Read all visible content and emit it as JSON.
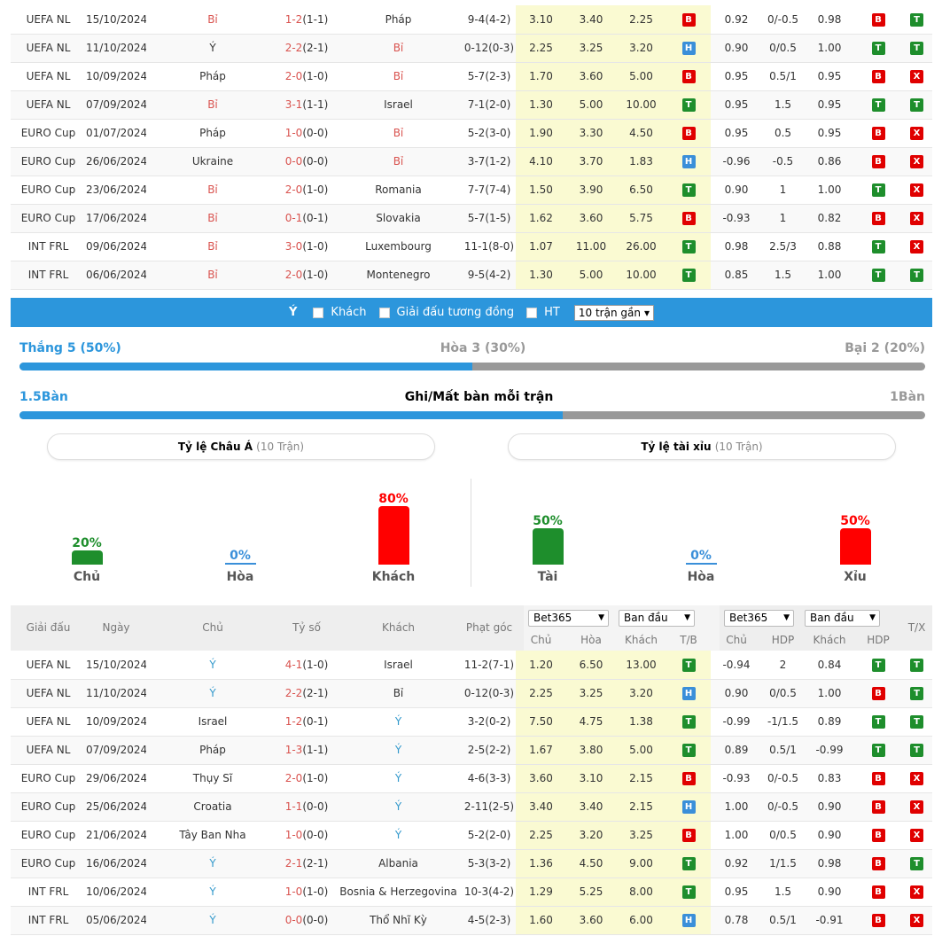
{
  "top_matches": [
    {
      "league": "UEFA NL",
      "date": "15/10/2024",
      "home": "Bỉ",
      "home_red": true,
      "score": "1-2",
      "ht": "(1-1)",
      "away": "Pháp",
      "away_red": false,
      "corners": "9-4(4-2)",
      "o1": "3.10",
      "o2": "3.40",
      "o3": "2.25",
      "res": "B",
      "h1": "0.92",
      "h2": "0/-0.5",
      "h3": "0.98",
      "r1": "B",
      "r2": "T"
    },
    {
      "league": "UEFA NL",
      "date": "11/10/2024",
      "home": "Ý",
      "home_red": false,
      "score": "2-2",
      "ht": "(2-1)",
      "away": "Bỉ",
      "away_red": true,
      "corners": "0-12(0-3)",
      "o1": "2.25",
      "o2": "3.25",
      "o3": "3.20",
      "res": "H",
      "h1": "0.90",
      "h2": "0/0.5",
      "h3": "1.00",
      "r1": "T",
      "r2": "T"
    },
    {
      "league": "UEFA NL",
      "date": "10/09/2024",
      "home": "Pháp",
      "home_red": false,
      "score": "2-0",
      "ht": "(1-0)",
      "away": "Bỉ",
      "away_red": true,
      "corners": "5-7(2-3)",
      "o1": "1.70",
      "o2": "3.60",
      "o3": "5.00",
      "res": "B",
      "h1": "0.95",
      "h2": "0.5/1",
      "h3": "0.95",
      "r1": "B",
      "r2": "X"
    },
    {
      "league": "UEFA NL",
      "date": "07/09/2024",
      "home": "Bỉ",
      "home_red": true,
      "score": "3-1",
      "ht": "(1-1)",
      "away": "Israel",
      "away_red": false,
      "corners": "7-1(2-0)",
      "o1": "1.30",
      "o2": "5.00",
      "o3": "10.00",
      "res": "T",
      "h1": "0.95",
      "h2": "1.5",
      "h3": "0.95",
      "r1": "T",
      "r2": "T"
    },
    {
      "league": "EURO Cup",
      "date": "01/07/2024",
      "home": "Pháp",
      "home_red": false,
      "score": "1-0",
      "ht": "(0-0)",
      "away": "Bỉ",
      "away_red": true,
      "corners": "5-2(3-0)",
      "o1": "1.90",
      "o2": "3.30",
      "o3": "4.50",
      "res": "B",
      "h1": "0.95",
      "h2": "0.5",
      "h3": "0.95",
      "r1": "B",
      "r2": "X"
    },
    {
      "league": "EURO Cup",
      "date": "26/06/2024",
      "home": "Ukraine",
      "home_red": false,
      "score": "0-0",
      "ht": "(0-0)",
      "away": "Bỉ",
      "away_red": true,
      "corners": "3-7(1-2)",
      "o1": "4.10",
      "o2": "3.70",
      "o3": "1.83",
      "res": "H",
      "h1": "-0.96",
      "h2": "-0.5",
      "h3": "0.86",
      "r1": "B",
      "r2": "X"
    },
    {
      "league": "EURO Cup",
      "date": "23/06/2024",
      "home": "Bỉ",
      "home_red": true,
      "score": "2-0",
      "ht": "(1-0)",
      "away": "Romania",
      "away_red": false,
      "corners": "7-7(7-4)",
      "o1": "1.50",
      "o2": "3.90",
      "o3": "6.50",
      "res": "T",
      "h1": "0.90",
      "h2": "1",
      "h3": "1.00",
      "r1": "T",
      "r2": "X"
    },
    {
      "league": "EURO Cup",
      "date": "17/06/2024",
      "home": "Bỉ",
      "home_red": true,
      "score": "0-1",
      "ht": "(0-1)",
      "away": "Slovakia",
      "away_red": false,
      "corners": "5-7(1-5)",
      "o1": "1.62",
      "o2": "3.60",
      "o3": "5.75",
      "res": "B",
      "h1": "-0.93",
      "h2": "1",
      "h3": "0.82",
      "r1": "B",
      "r2": "X"
    },
    {
      "league": "INT FRL",
      "date": "09/06/2024",
      "home": "Bỉ",
      "home_red": true,
      "score": "3-0",
      "ht": "(1-0)",
      "away": "Luxembourg",
      "away_red": false,
      "corners": "11-1(8-0)",
      "o1": "1.07",
      "o2": "11.00",
      "o3": "26.00",
      "res": "T",
      "h1": "0.98",
      "h2": "2.5/3",
      "h3": "0.88",
      "r1": "T",
      "r2": "X"
    },
    {
      "league": "INT FRL",
      "date": "06/06/2024",
      "home": "Bỉ",
      "home_red": true,
      "score": "2-0",
      "ht": "(1-0)",
      "away": "Montenegro",
      "away_red": false,
      "corners": "9-5(4-2)",
      "o1": "1.30",
      "o2": "5.00",
      "o3": "10.00",
      "res": "T",
      "h1": "0.85",
      "h2": "1.5",
      "h3": "1.00",
      "r1": "T",
      "r2": "T"
    }
  ],
  "filter": {
    "team": "Ý",
    "away_label": "Khách",
    "same_league_label": "Giải đấu tương đồng",
    "ht_label": "HT",
    "recent_select": "10 trận gần"
  },
  "record": {
    "win": "Thắng 5 (50%)",
    "draw": "Hòa 3 (30%)",
    "loss": "Bại 2 (20%)",
    "win_frac": 0.5
  },
  "goals": {
    "left": "1.5Bàn",
    "title": "Ghi/Mất bàn mỗi trận",
    "right": "1Bàn",
    "frac": 0.6
  },
  "asian": {
    "title": "Tỷ lệ Châu Á",
    "sub": "(10 Trận)",
    "bars": [
      {
        "label": "Chủ",
        "pct": "20%",
        "value": 20,
        "color": "#1e8e2c"
      },
      {
        "label": "Hòa",
        "pct": "0%",
        "value": 0,
        "color": "#3a8fd9"
      },
      {
        "label": "Khách",
        "pct": "80%",
        "value": 80,
        "color": "#ff0000"
      }
    ]
  },
  "ou": {
    "title": "Tỷ lệ tài xỉu",
    "sub": "(10 Trận)",
    "bars": [
      {
        "label": "Tài",
        "pct": "50%",
        "value": 50,
        "color": "#1e8e2c"
      },
      {
        "label": "Hòa",
        "pct": "0%",
        "value": 0,
        "color": "#3a8fd9"
      },
      {
        "label": "Xỉu",
        "pct": "50%",
        "value": 50,
        "color": "#ff0000"
      }
    ]
  },
  "header": {
    "league": "Giải đấu",
    "date": "Ngày",
    "home": "Chủ",
    "score": "Tỷ số",
    "away": "Khách",
    "corners": "Phạt góc",
    "book1": "Bet365",
    "type1": "Ban đầu",
    "book2": "Bet365",
    "type2": "Ban đầu",
    "sub_home": "Chủ",
    "sub_draw": "Hòa",
    "sub_away": "Khách",
    "sub_tb": "T/B",
    "sub_home2": "Chủ",
    "sub_hdp": "HDP",
    "sub_away2": "Khách",
    "sub_hdp2": "HDP",
    "tx": "T/X"
  },
  "bottom_matches": [
    {
      "league": "UEFA NL",
      "date": "15/10/2024",
      "home": "Ý",
      "home_blue": true,
      "score": "4-1",
      "ht": "(1-0)",
      "away": "Israel",
      "away_blue": false,
      "corners": "11-2(7-1)",
      "o1": "1.20",
      "o2": "6.50",
      "o3": "13.00",
      "res": "T",
      "h1": "-0.94",
      "h2": "2",
      "h3": "0.84",
      "r1": "T",
      "r2": "T"
    },
    {
      "league": "UEFA NL",
      "date": "11/10/2024",
      "home": "Ý",
      "home_blue": true,
      "score": "2-2",
      "ht": "(2-1)",
      "away": "Bỉ",
      "away_blue": false,
      "corners": "0-12(0-3)",
      "o1": "2.25",
      "o2": "3.25",
      "o3": "3.20",
      "res": "H",
      "h1": "0.90",
      "h2": "0/0.5",
      "h3": "1.00",
      "r1": "B",
      "r2": "T"
    },
    {
      "league": "UEFA NL",
      "date": "10/09/2024",
      "home": "Israel",
      "home_blue": false,
      "score": "1-2",
      "ht": "(0-1)",
      "away": "Ý",
      "away_blue": true,
      "corners": "3-2(0-2)",
      "o1": "7.50",
      "o2": "4.75",
      "o3": "1.38",
      "res": "T",
      "h1": "-0.99",
      "h2": "-1/1.5",
      "h3": "0.89",
      "r1": "T",
      "r2": "T"
    },
    {
      "league": "UEFA NL",
      "date": "07/09/2024",
      "home": "Pháp",
      "home_blue": false,
      "score": "1-3",
      "ht": "(1-1)",
      "away": "Ý",
      "away_blue": true,
      "corners": "2-5(2-2)",
      "o1": "1.67",
      "o2": "3.80",
      "o3": "5.00",
      "res": "T",
      "h1": "0.89",
      "h2": "0.5/1",
      "h3": "-0.99",
      "r1": "T",
      "r2": "T"
    },
    {
      "league": "EURO Cup",
      "date": "29/06/2024",
      "home": "Thụy Sĩ",
      "home_blue": false,
      "score": "2-0",
      "ht": "(1-0)",
      "away": "Ý",
      "away_blue": true,
      "corners": "4-6(3-3)",
      "o1": "3.60",
      "o2": "3.10",
      "o3": "2.15",
      "res": "B",
      "h1": "-0.93",
      "h2": "0/-0.5",
      "h3": "0.83",
      "r1": "B",
      "r2": "X"
    },
    {
      "league": "EURO Cup",
      "date": "25/06/2024",
      "home": "Croatia",
      "home_blue": false,
      "score": "1-1",
      "ht": "(0-0)",
      "away": "Ý",
      "away_blue": true,
      "corners": "2-11(2-5)",
      "o1": "3.40",
      "o2": "3.40",
      "o3": "2.15",
      "res": "H",
      "h1": "1.00",
      "h2": "0/-0.5",
      "h3": "0.90",
      "r1": "B",
      "r2": "X"
    },
    {
      "league": "EURO Cup",
      "date": "21/06/2024",
      "home": "Tây Ban Nha",
      "home_blue": false,
      "score": "1-0",
      "ht": "(0-0)",
      "away": "Ý",
      "away_blue": true,
      "corners": "5-2(2-0)",
      "o1": "2.25",
      "o2": "3.20",
      "o3": "3.25",
      "res": "B",
      "h1": "1.00",
      "h2": "0/0.5",
      "h3": "0.90",
      "r1": "B",
      "r2": "X"
    },
    {
      "league": "EURO Cup",
      "date": "16/06/2024",
      "home": "Ý",
      "home_blue": true,
      "score": "2-1",
      "ht": "(2-1)",
      "away": "Albania",
      "away_blue": false,
      "corners": "5-3(3-2)",
      "o1": "1.36",
      "o2": "4.50",
      "o3": "9.00",
      "res": "T",
      "h1": "0.92",
      "h2": "1/1.5",
      "h3": "0.98",
      "r1": "B",
      "r2": "T"
    },
    {
      "league": "INT FRL",
      "date": "10/06/2024",
      "home": "Ý",
      "home_blue": true,
      "score": "1-0",
      "ht": "(1-0)",
      "away": "Bosnia & Herzegovina",
      "away_blue": false,
      "corners": "10-3(4-2)",
      "o1": "1.29",
      "o2": "5.25",
      "o3": "8.00",
      "res": "T",
      "h1": "0.95",
      "h2": "1.5",
      "h3": "0.90",
      "r1": "B",
      "r2": "X"
    },
    {
      "league": "INT FRL",
      "date": "05/06/2024",
      "home": "Ý",
      "home_blue": true,
      "score": "0-0",
      "ht": "(0-0)",
      "away": "Thổ Nhĩ Kỳ",
      "away_blue": false,
      "corners": "4-5(2-3)",
      "o1": "1.60",
      "o2": "3.60",
      "o3": "6.00",
      "res": "H",
      "h1": "0.78",
      "h2": "0.5/1",
      "h3": "-0.91",
      "r1": "B",
      "r2": "X"
    }
  ]
}
